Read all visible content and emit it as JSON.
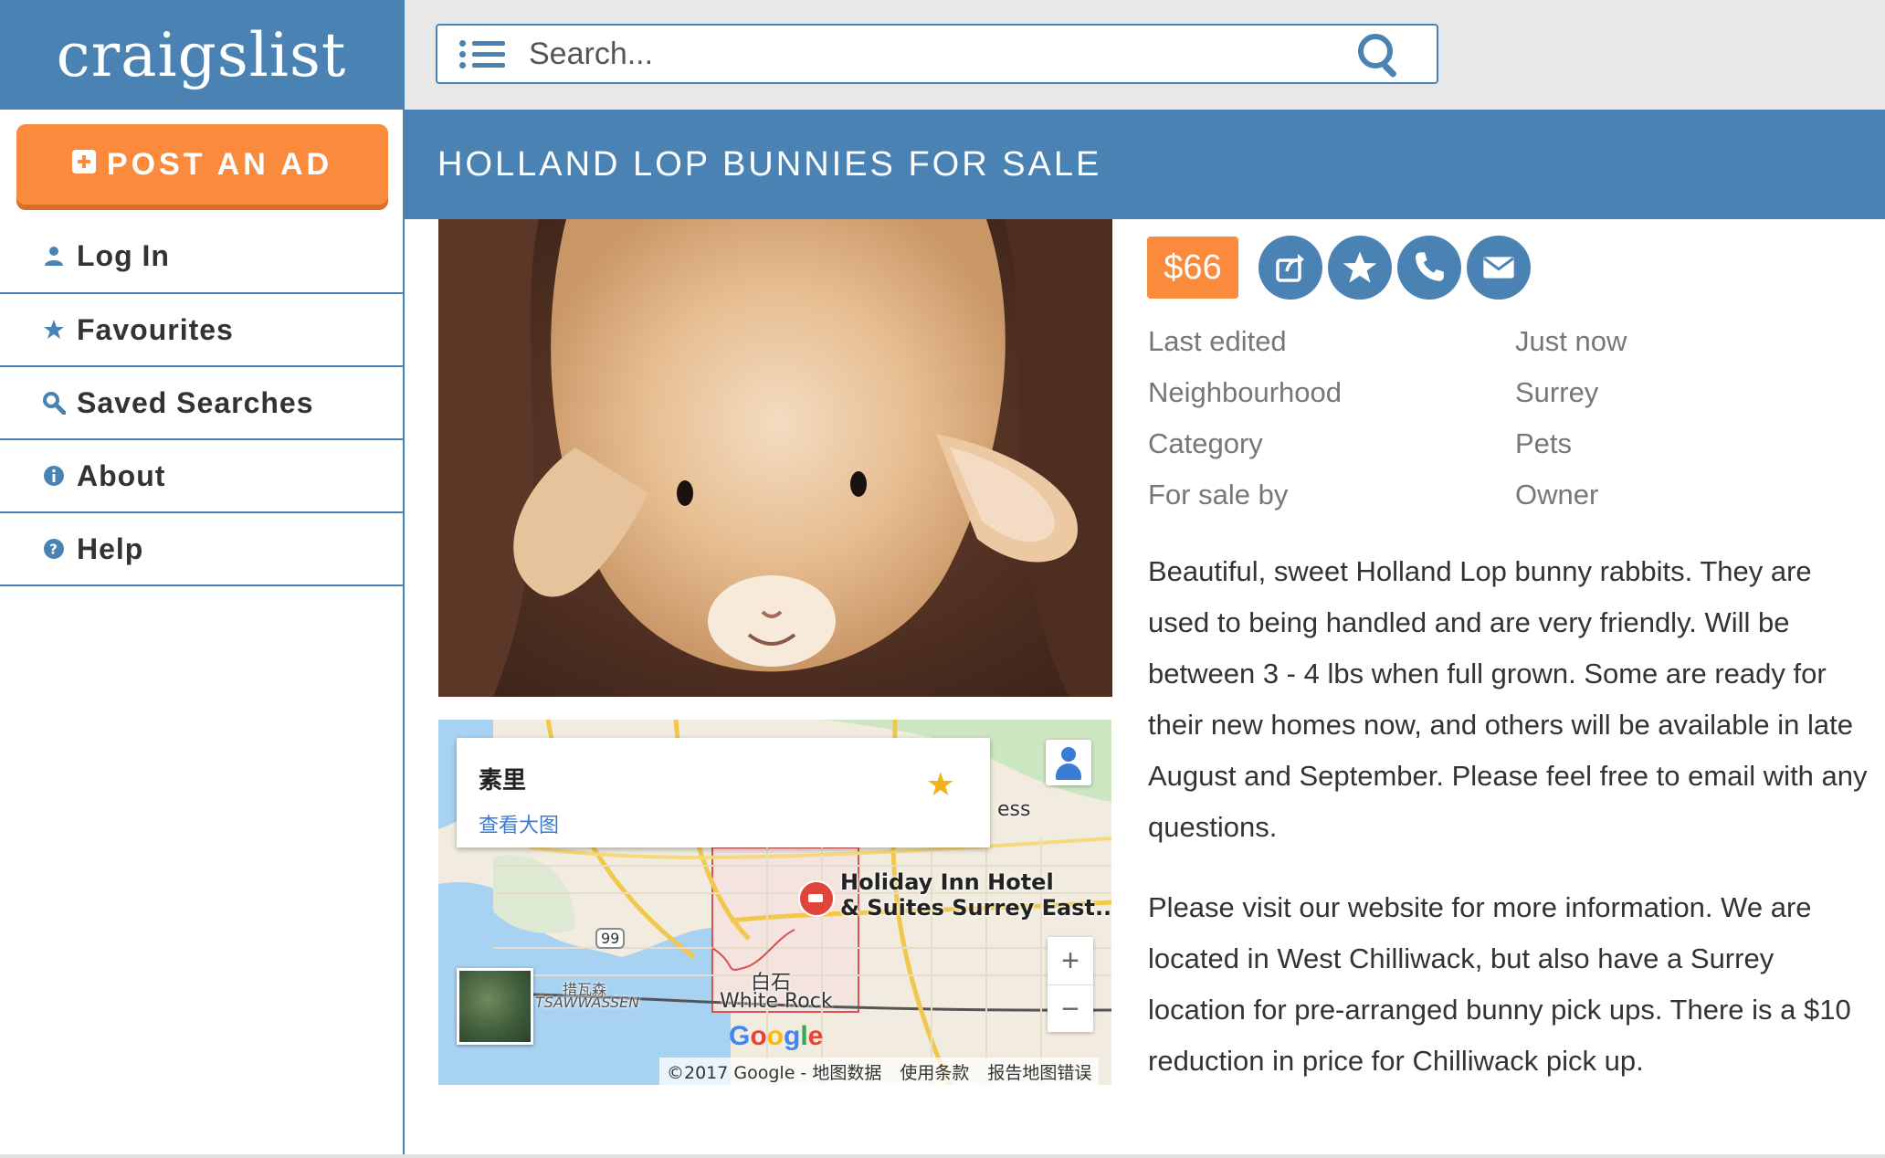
{
  "brand": {
    "logo_text": "craigslist",
    "accent_color": "#4a82b3",
    "cta_color": "#fa8a3c"
  },
  "sidebar": {
    "post_ad_label": "POST AN AD",
    "items": [
      {
        "label": "Log In",
        "icon": "user-icon"
      },
      {
        "label": "Favourites",
        "icon": "star-icon"
      },
      {
        "label": "Saved Searches",
        "icon": "magnifier-icon"
      },
      {
        "label": "About",
        "icon": "info-icon"
      },
      {
        "label": "Help",
        "icon": "help-icon"
      }
    ]
  },
  "search": {
    "placeholder": "Search...",
    "value": ""
  },
  "listing": {
    "title": "HOLLAND LOP BUNNIES FOR SALE",
    "price": "$66",
    "details": [
      {
        "label": "Last edited",
        "value": "Just now"
      },
      {
        "label": "Neighbourhood",
        "value": "Surrey"
      },
      {
        "label": "Category",
        "value": "Pets"
      },
      {
        "label": "For sale by",
        "value": "Owner"
      }
    ],
    "description": [
      "Beautiful, sweet Holland Lop bunny rabbits. They are used to being handled and are very friendly. Will be between 3 - 4 lbs when full grown. Some are ready for their new homes now, and others will be available in late August and September. Please feel free to email with any questions.",
      "Please visit our website for more information. We are located in West Chilliwack, but also have a Surrey location for pre-arranged bunny pick ups. There is a $10 reduction in price for Chilliwack pick up."
    ]
  },
  "map": {
    "place_name": "素里",
    "view_larger": "查看大图",
    "hotel": "Holiday Inn Hotel\n& Suites Surrey East...",
    "labels": {
      "white_rock_cn": "白石",
      "white_rock": "White Rock",
      "tsawwassen_cn": "措瓦森",
      "tsawwassen": "TSAWWASSEN",
      "highway": "99",
      "partial_ess": "ess"
    },
    "zoom_in": "+",
    "zoom_out": "−",
    "attribution": "©2017 Google - 地图数据",
    "terms": "使用条款",
    "report": "报告地图错误"
  }
}
